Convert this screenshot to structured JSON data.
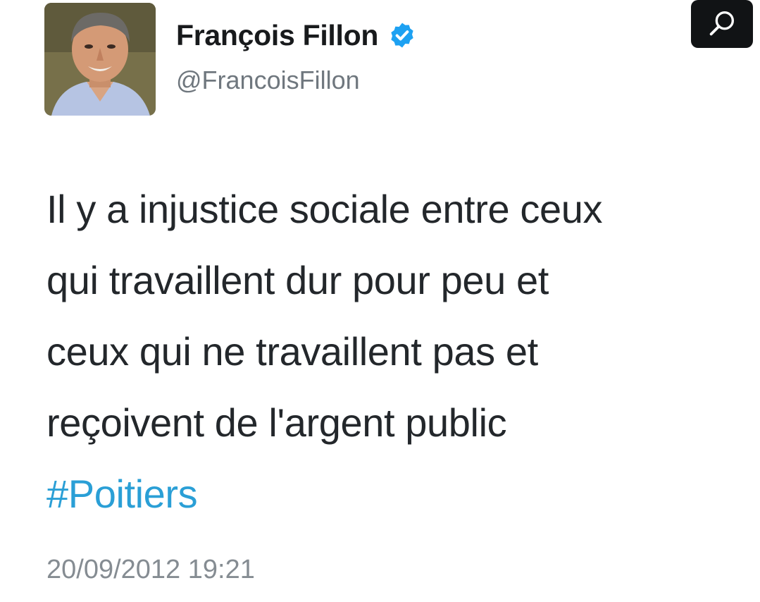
{
  "header": {
    "display_name": "François Fillon",
    "handle": "@FrancoisFillon",
    "verified_icon": "verified-badge-icon",
    "search_icon": "search-icon"
  },
  "tweet": {
    "lines": [
      "Il y a injustice sociale entre ceux",
      "qui travaillent dur pour peu et",
      "ceux qui ne travaillent pas et",
      "reçoivent de l'argent public"
    ],
    "hashtag": "#Poitiers",
    "timestamp": "20/09/2012 19:21"
  },
  "colors": {
    "hashtag": "#2a9fd6",
    "verified": "#1da1f2",
    "search_button": "#111315",
    "text": "#23272b",
    "muted": "#858c92"
  }
}
